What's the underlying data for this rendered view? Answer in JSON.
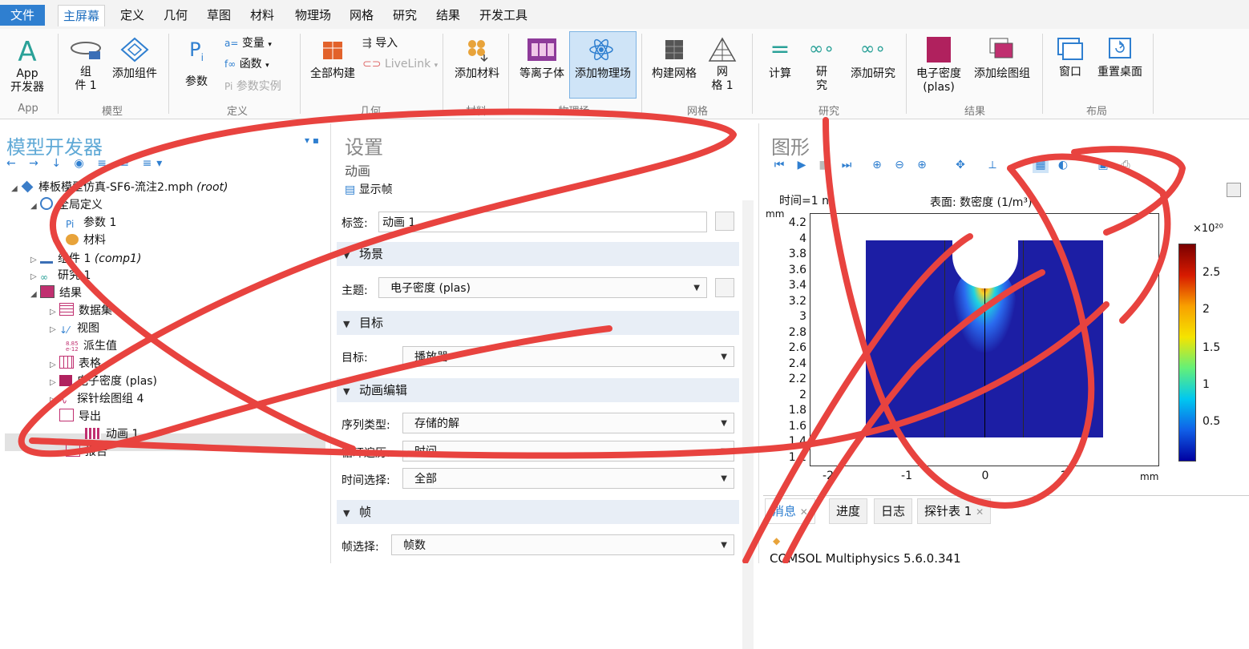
{
  "menu": [
    "文件",
    "主屏幕",
    "定义",
    "几何",
    "草图",
    "材料",
    "物理场",
    "网格",
    "研究",
    "结果",
    "开发工具"
  ],
  "ribbon": {
    "app_dev": "App\n开发器",
    "component": "组\n件 1",
    "add_component": "添加组件",
    "params": "参数",
    "variables": "变量",
    "functions": "函数",
    "param_instance": "参数实例",
    "build_all": "全部构建",
    "import": "导入",
    "livelink": "LiveLink",
    "add_material": "添加材料",
    "plasma": "等离子体",
    "add_physics": "添加物理场",
    "build_mesh": "构建网格",
    "mesh1": "网\n格 1",
    "compute": "计算",
    "study": "研\n究",
    "add_study": "添加研究",
    "electron_density": "电子密度\n(plas)",
    "add_plot_group": "添加绘图组",
    "window": "窗口",
    "reset_desktop": "重置桌面",
    "groups": [
      "App",
      "模型",
      "定义",
      "几何",
      "材料",
      "物理场",
      "网格",
      "研究",
      "结果",
      "布局"
    ]
  },
  "model_builder": {
    "title": "模型开发器",
    "root": "棒板模型仿真-SF6-流注2.mph",
    "root_tag": "(root)",
    "items": [
      {
        "label": "全局定义"
      },
      {
        "label": "参数 1"
      },
      {
        "label": "材料"
      },
      {
        "label": "组件 1",
        "tag": "(comp1)"
      },
      {
        "label": "研究 1"
      },
      {
        "label": "结果"
      },
      {
        "label": "数据集"
      },
      {
        "label": "视图"
      },
      {
        "label": "派生值"
      },
      {
        "label": "表格"
      },
      {
        "label": "电子密度 (plas)"
      },
      {
        "label": "探针绘图组 4"
      },
      {
        "label": "导出"
      },
      {
        "label": "动画 1"
      },
      {
        "label": "报告"
      }
    ]
  },
  "settings": {
    "title": "设置",
    "subtitle": "动画",
    "show_frame": "显示帧",
    "label_label": "标签:",
    "label_value": "动画 1",
    "sections": [
      "场景",
      "目标",
      "动画编辑",
      "帧"
    ],
    "subject_label": "主题:",
    "subject_value": "电子密度 (plas)",
    "target_label": "目标:",
    "target_value": "播放器",
    "seq_label": "序列类型:",
    "seq_value": "存储的解",
    "loop_label": "循环遍历:",
    "loop_value": "时间",
    "time_sel_label": "时间选择:",
    "time_sel_value": "全部",
    "frame_sel_label": "帧选择:",
    "frame_sel_value": "帧数"
  },
  "graphics": {
    "title": "图形",
    "time_text": "时间=1 ns",
    "surface_text": "表面: 数密度 (1/m³)",
    "y_unit": "mm",
    "x_unit": "mm",
    "y_ticks": [
      "4.2",
      "4",
      "3.8",
      "3.6",
      "3.4",
      "3.2",
      "3",
      "2.8",
      "2.6",
      "2.4",
      "2.2",
      "2",
      "1.8",
      "1.6",
      "1.4",
      "1.2"
    ],
    "x_ticks": [
      "-2",
      "-1",
      "0",
      "1"
    ],
    "colorbar_exp": "×10²⁰",
    "colorbar_ticks": [
      "2.5",
      "2",
      "1.5",
      "1",
      "0.5"
    ]
  },
  "bottom_tabs": [
    "消息",
    "进度",
    "日志",
    "探针表 1"
  ],
  "console_text": "COMSOL Multiphysics 5.6.0.341"
}
